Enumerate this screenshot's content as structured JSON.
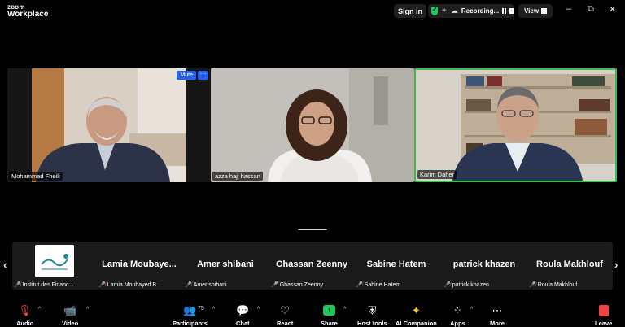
{
  "titlebar": {
    "logo_line1": "zoom",
    "logo_line2": "Workplace",
    "sign_in": "Sign in",
    "recording": "Recording...",
    "view": "View"
  },
  "tiles": [
    {
      "name": "Mohammad Fheili",
      "mute_label": "Mute",
      "more_label": "···"
    },
    {
      "name": "azza hajj hassan"
    },
    {
      "name": "Karim Daher"
    }
  ],
  "gallery": [
    {
      "display": "",
      "tag": "Institut des Financ..."
    },
    {
      "display": "Lamia   Moubaye...",
      "tag": "Lamia Moubayed B..."
    },
    {
      "display": "Amer shibani",
      "tag": "Amer shibani"
    },
    {
      "display": "Ghassan Zeenny",
      "tag": "Ghassan Zeenny"
    },
    {
      "display": "Sabine Hatem",
      "tag": "Sabine Hatem"
    },
    {
      "display": "patrick khazen",
      "tag": "patrick khazen"
    },
    {
      "display": "Roula Makhlouf",
      "tag": "Roula Makhlouf"
    }
  ],
  "toolbar": {
    "audio": "Audio",
    "video": "Video",
    "participants": "Participants",
    "participants_count": "75",
    "chat": "Chat",
    "react": "React",
    "share": "Share",
    "host_tools": "Host tools",
    "ai_companion": "AI Companion",
    "apps": "Apps",
    "more": "More",
    "leave": "Leave"
  },
  "colors": {
    "active_speaker_border": "#3dbb4f",
    "mute_button": "#2563eb",
    "share_green": "#22c55e",
    "leave_red": "#ef4444"
  }
}
